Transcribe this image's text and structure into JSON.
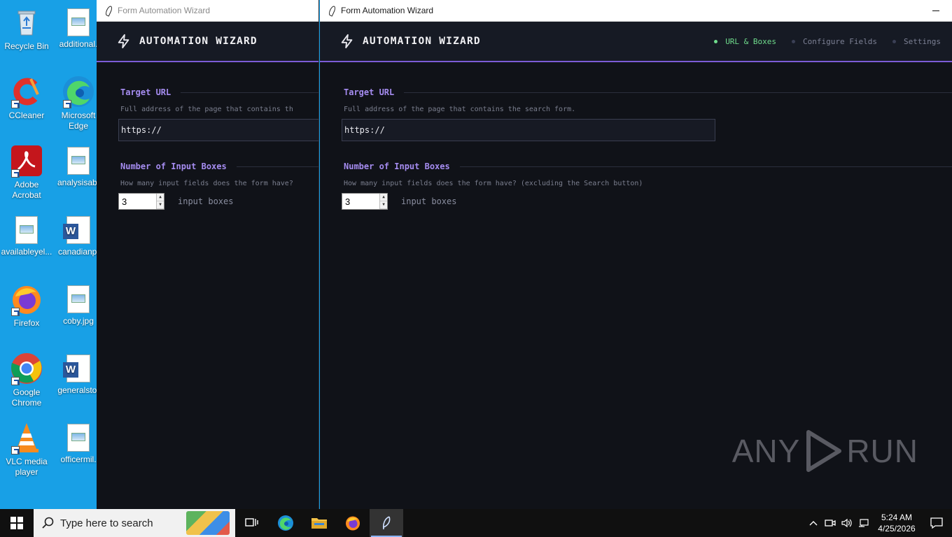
{
  "desktop": {
    "icons": [
      {
        "label": "Recycle Bin",
        "icon": "recycle-bin-icon"
      },
      {
        "label": "additional.",
        "icon": "image-file-icon"
      },
      {
        "label": "CCleaner",
        "icon": "ccleaner-icon"
      },
      {
        "label": "Microsoft Edge",
        "icon": "edge-icon"
      },
      {
        "label": "Adobe Acrobat",
        "icon": "acrobat-icon"
      },
      {
        "label": "analysisab.",
        "icon": "image-file-icon"
      },
      {
        "label": "availableyel...",
        "icon": "image-file-icon"
      },
      {
        "label": "canadianpi",
        "icon": "word-doc-icon"
      },
      {
        "label": "Firefox",
        "icon": "firefox-icon"
      },
      {
        "label": "coby.jpg",
        "icon": "image-file-icon"
      },
      {
        "label": "Google Chrome",
        "icon": "chrome-icon"
      },
      {
        "label": "generalsto.",
        "icon": "word-doc-icon"
      },
      {
        "label": "VLC media player",
        "icon": "vlc-icon"
      },
      {
        "label": "officermil.",
        "icon": "image-file-icon"
      }
    ]
  },
  "windows": {
    "left": {
      "title": "Form Automation Wizard",
      "app_title": "AUTOMATION WIZARD",
      "url_section": "Target URL",
      "url_desc": "Full address of the page that contains th",
      "url_value": "https://",
      "boxes_section": "Number of Input Boxes",
      "boxes_desc": "How many input fields does the form have?",
      "boxes_value": "3",
      "boxes_suffix": "input boxes"
    },
    "right": {
      "title": "Form Automation Wizard",
      "app_title": "AUTOMATION WIZARD",
      "steps": [
        "URL & Boxes",
        "Configure Fields",
        "Settings"
      ],
      "active_step": 0,
      "url_section": "Target URL",
      "url_desc": "Full address of the page that contains the search form.",
      "url_value": "https://",
      "boxes_section": "Number of Input Boxes",
      "boxes_desc": "How many input fields does the form have? (excluding the Search button)",
      "boxes_value": "3",
      "boxes_suffix": "input boxes"
    }
  },
  "watermark": {
    "left": "ANY",
    "right": "RUN"
  },
  "taskbar": {
    "search_placeholder": "Type here to search",
    "time": "5:24 AM",
    "date": "4/25/2026"
  },
  "colors": {
    "accent": "#7c5cd6",
    "section_title": "#a58cf0",
    "active_step": "#6fdc8c",
    "app_bg": "#101218",
    "desktop_bg": "#18a0e6"
  }
}
